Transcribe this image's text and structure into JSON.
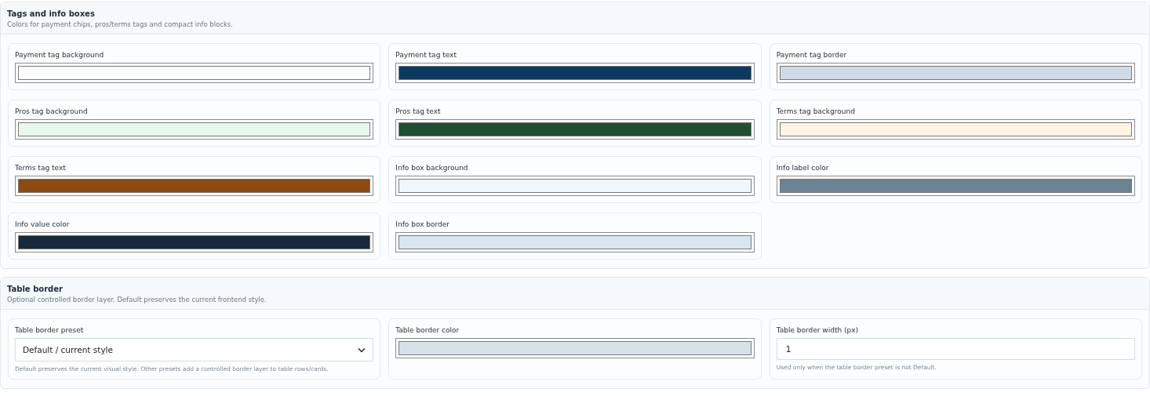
{
  "sections": [
    {
      "title": "Tags and info boxes",
      "description": "Colors for payment chips, pros/terms tags and compact info blocks.",
      "fields": [
        {
          "kind": "color",
          "label": "Payment tag background",
          "color": "#fbfdff"
        },
        {
          "kind": "color",
          "label": "Payment tag text",
          "color": "#0b3a5e"
        },
        {
          "kind": "color",
          "label": "Payment tag border",
          "color": "#cfdbe6"
        },
        {
          "kind": "color",
          "label": "Pros tag background",
          "color": "#eaf7ee"
        },
        {
          "kind": "color",
          "label": "Pros tag text",
          "color": "#214d33"
        },
        {
          "kind": "color",
          "label": "Terms tag background",
          "color": "#fff4e2"
        },
        {
          "kind": "color",
          "label": "Terms tag text",
          "color": "#8b4a0f"
        },
        {
          "kind": "color",
          "label": "Info box background",
          "color": "#f1f6fb"
        },
        {
          "kind": "color",
          "label": "Info label color",
          "color": "#6b8392"
        },
        {
          "kind": "color",
          "label": "Info value color",
          "color": "#15293a"
        },
        {
          "kind": "color",
          "label": "Info box border",
          "color": "#d9e5ef"
        }
      ]
    },
    {
      "title": "Table border",
      "description": "Optional controlled border layer. Default preserves the current frontend style.",
      "fields": [
        {
          "kind": "select",
          "label": "Table border preset",
          "value": "Default / current style",
          "help": "Default preserves the current visual style. Other presets add a controlled border layer to table rows/cards."
        },
        {
          "kind": "color",
          "label": "Table border color",
          "color": "#d8e1e9"
        },
        {
          "kind": "number",
          "label": "Table border width (px)",
          "value": "1",
          "help": "Used only when the table border preset is not Default."
        }
      ]
    }
  ]
}
